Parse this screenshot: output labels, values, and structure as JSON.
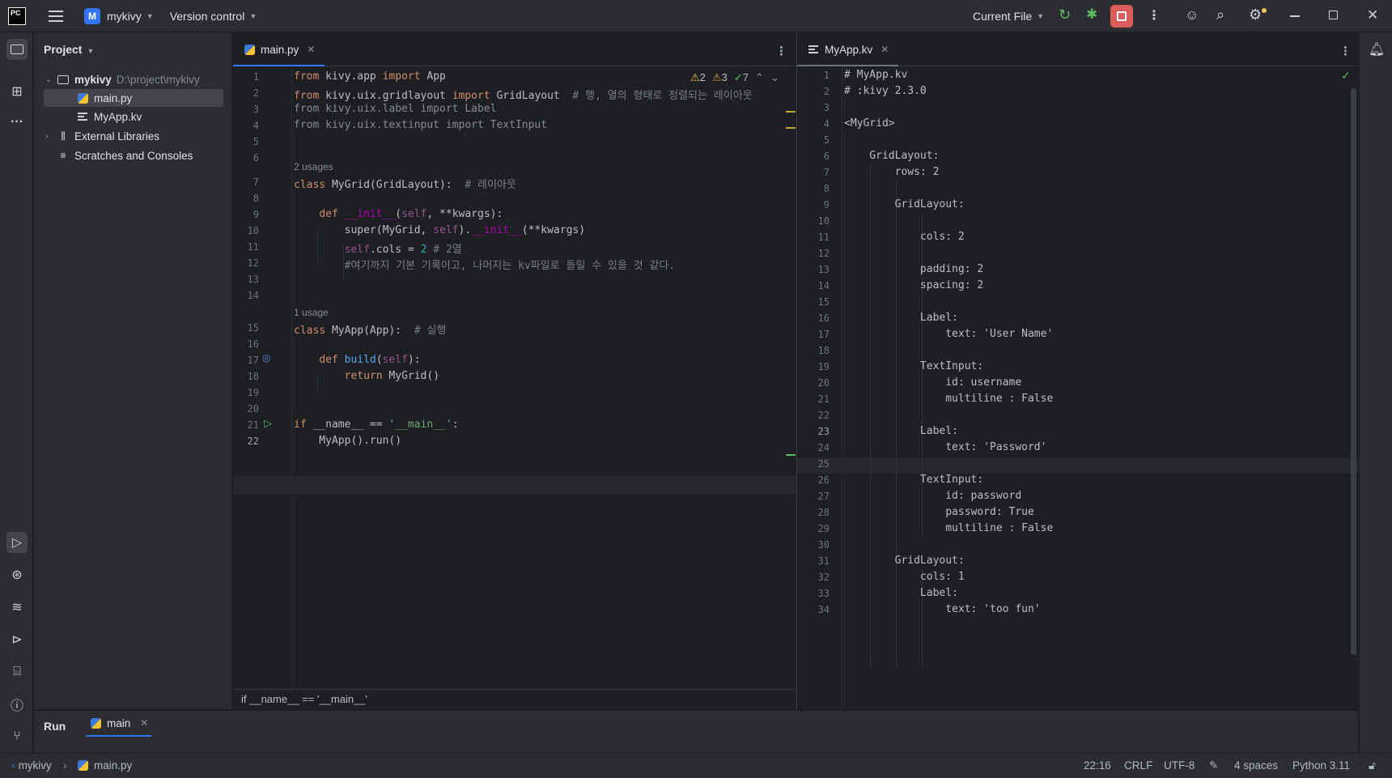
{
  "titlebar": {
    "logo": "PC",
    "project_badge": "M",
    "project_name": "mykivy",
    "vcs": "Version control",
    "run_config": "Current File",
    "icons": [
      "hamburger-icon",
      "rerun-icon",
      "debug-icon",
      "stop-icon",
      "more-icon",
      "add-user-icon",
      "search-icon",
      "settings-icon",
      "minimize-icon",
      "maximize-icon",
      "close-icon"
    ]
  },
  "project_panel": {
    "title": "Project",
    "tree": [
      {
        "label": "mykivy",
        "path": "D:\\project\\mykivy"
      },
      {
        "label": "main.py"
      },
      {
        "label": "MyApp.kv"
      },
      {
        "label": "External Libraries"
      },
      {
        "label": "Scratches and Consoles"
      }
    ]
  },
  "left_editor": {
    "tab": "main.py",
    "inspections": {
      "warnings": "2",
      "weak_warnings": "3",
      "typos": "7"
    },
    "hints": {
      "usages2": "2 usages",
      "usage1": "1 usage"
    },
    "breadcrumb": "if __name__ == '__main__'",
    "line_numbers": [
      "1",
      "2",
      "3",
      "4",
      "5",
      "6",
      "7",
      "8",
      "9",
      "10",
      "11",
      "12",
      "13",
      "14",
      "15",
      "16",
      "17",
      "18",
      "19",
      "20",
      "21",
      "22"
    ],
    "comments": {
      "l2": "# 행, 열의 형태로 정렬되는 레이아웃",
      "l7": "# 레이아웃",
      "l11": "# 2열",
      "l12": "#여기까지 기본 기록이고, 나머지는 kv파일로 돌릴 수 있을 것 같다.",
      "l15": "# 실행"
    }
  },
  "right_editor": {
    "tab": "MyApp.kv",
    "lines": [
      "# MyApp.kv",
      "# :kivy 2.3.0",
      "",
      "<MyGrid>",
      "",
      "    GridLayout:",
      "        rows: 2",
      "",
      "        GridLayout:",
      "",
      "            cols: 2",
      "",
      "            padding: 2",
      "            spacing: 2",
      "",
      "            Label:",
      "                text: 'User Name'",
      "",
      "            TextInput:",
      "                id: username",
      "                multiline : False",
      "",
      "            Label:",
      "                text: 'Password'",
      "",
      "            TextInput:",
      "                id: password",
      "                password: True",
      "                multiline : False",
      "",
      "        GridLayout:",
      "            cols: 1",
      "            Label:",
      "                text: 'too fun'"
    ]
  },
  "run_panel": {
    "title": "Run",
    "tab": "main"
  },
  "statusbar": {
    "project": "mykivy",
    "file": "main.py",
    "position": "22:16",
    "line_sep": "CRLF",
    "encoding": "UTF-8",
    "indent": "4 spaces",
    "interpreter": "Python 3.11"
  },
  "colors": {
    "accent": "#3574f0",
    "bg": "#1e1f22",
    "panel": "#2b2d30"
  }
}
